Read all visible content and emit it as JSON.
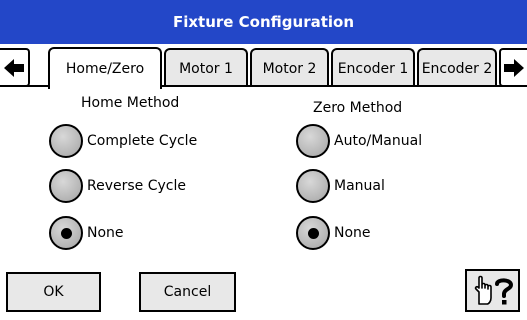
{
  "window": {
    "title": "Fixture Configuration"
  },
  "tabs": [
    {
      "label": "Home/Zero",
      "active": true
    },
    {
      "label": "Motor 1",
      "active": false
    },
    {
      "label": "Motor 2",
      "active": false
    },
    {
      "label": "Encoder 1",
      "active": false
    },
    {
      "label": "Encoder 2",
      "active": false
    }
  ],
  "home_method": {
    "label": "Home Method",
    "options": [
      {
        "label": "Complete Cycle",
        "selected": false
      },
      {
        "label": "Reverse Cycle",
        "selected": false
      },
      {
        "label": "None",
        "selected": true
      }
    ]
  },
  "zero_method": {
    "label": "Zero Method",
    "options": [
      {
        "label": "Auto/Manual",
        "selected": false
      },
      {
        "label": "Manual",
        "selected": false
      },
      {
        "label": "None",
        "selected": true
      }
    ]
  },
  "buttons": {
    "ok": "OK",
    "cancel": "Cancel",
    "help_icon": "hand-question-icon"
  },
  "colors": {
    "titlebar": "#2347c8",
    "radio_fill": "#b4b4b4",
    "button_fill": "#e8e8e8"
  }
}
